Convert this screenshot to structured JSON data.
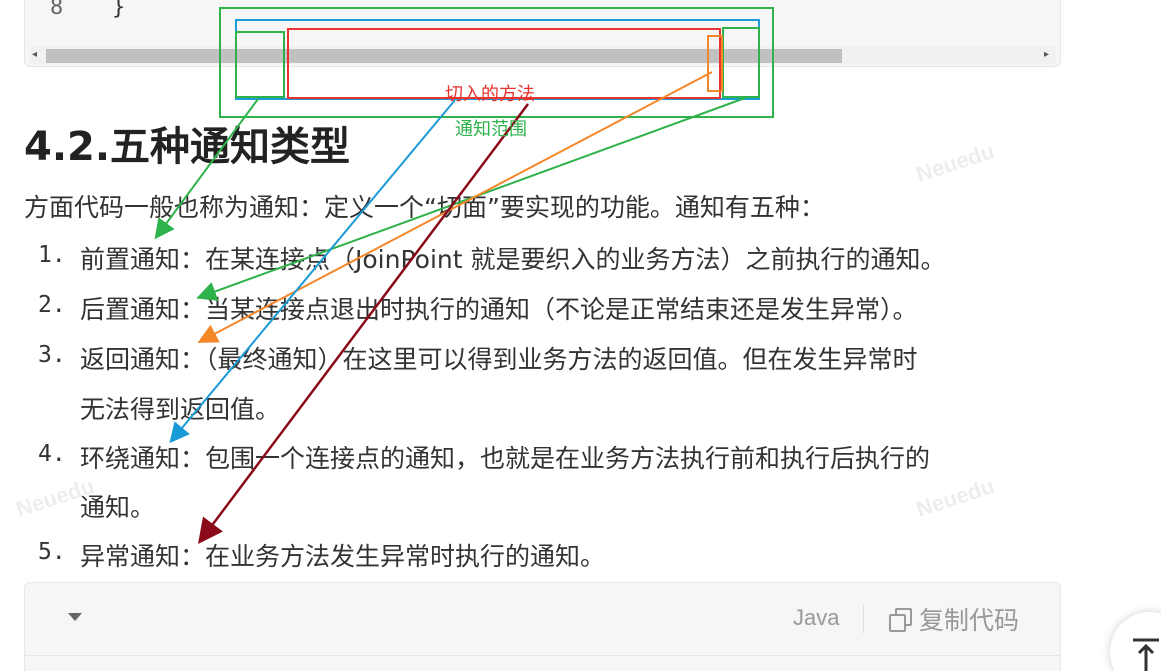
{
  "code_top": {
    "line_number": "8",
    "line_code": "}"
  },
  "heading": "4.2.五种通知类型",
  "intro": "方面代码一般也称为通知：定义一个“切面”要实现的功能。通知有五种：",
  "list": [
    {
      "num": "1.",
      "lines": [
        "前置通知：在某连接点（JoinPoint 就是要织入的业务方法）之前执行的通知。"
      ]
    },
    {
      "num": "2.",
      "lines": [
        "后置通知：当某连接点退出时执行的通知（不论是正常结束还是发生异常）。"
      ]
    },
    {
      "num": "3.",
      "lines": [
        "返回通知：（最终通知）在这里可以得到业务方法的返回值。但在发生异常时",
        "无法得到返回值。"
      ]
    },
    {
      "num": "4.",
      "lines": [
        "环绕通知：包围一个连接点的通知，也就是在业务方法执行前和执行后执行的",
        "通知。"
      ]
    },
    {
      "num": "5.",
      "lines": [
        "异常通知：在业务方法发生异常时执行的通知。"
      ]
    }
  ],
  "code_bottom": {
    "language": "Java",
    "copy_label": "复制代码"
  },
  "annotations": {
    "red_label": "切入的方法",
    "green_label": "通知范围",
    "colors": {
      "red": "#e8332f",
      "green": "#2eb24a",
      "blue": "#1a9ad6",
      "orange": "#f5872b",
      "darkred": "#8b0a1a"
    }
  },
  "watermark": "Neuedu",
  "icons": {
    "collapse": "chevron-down-icon",
    "copy": "copy-icon",
    "back_to_top": "arrow-up-to-line-icon"
  }
}
